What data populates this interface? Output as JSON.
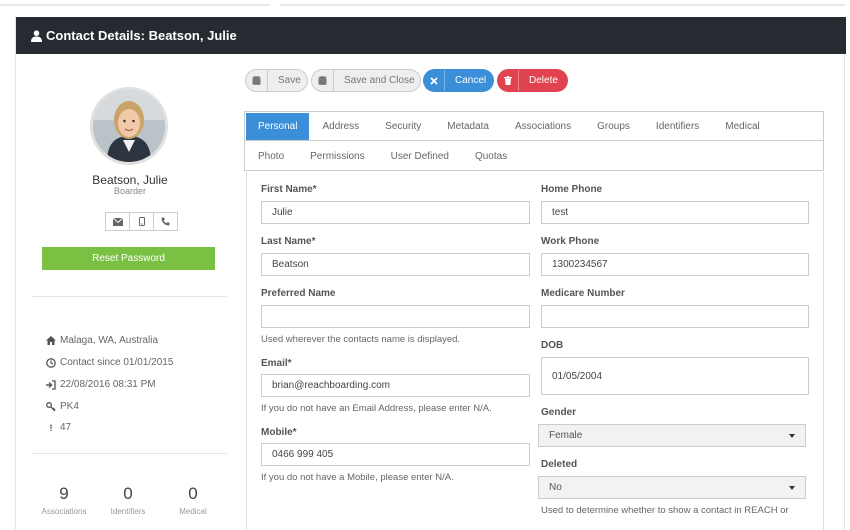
{
  "header": {
    "title": "Contact Details: Beatson, Julie"
  },
  "profile": {
    "name": "Beatson, Julie",
    "role": "Boarder",
    "reset_label": "Reset Password",
    "location": "Malaga, WA, Australia",
    "contact_since": "Contact since 01/01/2015",
    "last_login": "22/08/2016 08:31 PM",
    "key": "PK4",
    "id_number": "47",
    "stats": [
      {
        "value": "9",
        "label": "Associations"
      },
      {
        "value": "0",
        "label": "Identifiers"
      },
      {
        "value": "0",
        "label": "Medical"
      }
    ]
  },
  "toolbar": {
    "save": "Save",
    "save_close": "Save and Close",
    "cancel": "Cancel",
    "delete": "Delete"
  },
  "tabs": {
    "row1": [
      "Personal",
      "Address",
      "Security",
      "Metadata",
      "Associations",
      "Groups",
      "Identifiers",
      "Medical"
    ],
    "row2": [
      "Photo",
      "Permissions",
      "User Defined",
      "Quotas"
    ],
    "active": "Personal"
  },
  "form": {
    "first_name": {
      "label": "First Name*",
      "value": "Julie"
    },
    "last_name": {
      "label": "Last Name*",
      "value": "Beatson"
    },
    "preferred_name": {
      "label": "Preferred Name",
      "value": "",
      "help": "Used wherever the contacts name is displayed."
    },
    "email": {
      "label": "Email*",
      "value": "brian@reachboarding.com",
      "help": "If you do not have an Email Address, please enter N/A."
    },
    "mobile": {
      "label": "Mobile*",
      "value": "0466 999 405",
      "help": "If you do not have a Mobile, please enter N/A."
    },
    "home_phone": {
      "label": "Home Phone",
      "value": "test"
    },
    "work_phone": {
      "label": "Work Phone",
      "value": "1300234567"
    },
    "medicare": {
      "label": "Medicare Number",
      "value": ""
    },
    "dob": {
      "label": "DOB",
      "value": "01/05/2004"
    },
    "gender": {
      "label": "Gender",
      "value": "Female"
    },
    "deleted": {
      "label": "Deleted",
      "value": "No",
      "help": "Used to determine whether to show a contact in REACH or"
    }
  },
  "colors": {
    "header_bg": "#252b30",
    "primary": "#3a8fd8",
    "danger": "#e0434f",
    "success": "#7ac143"
  }
}
